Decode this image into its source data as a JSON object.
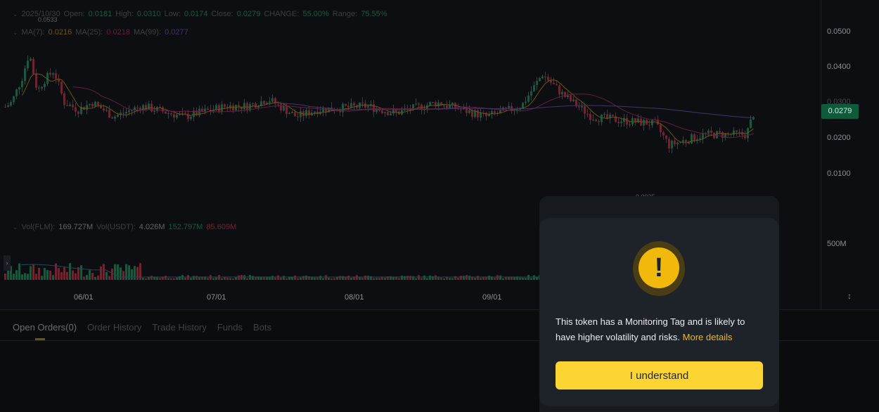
{
  "ohlc": {
    "date": "2025/10/30",
    "open_label": "Open:",
    "open": "0.0181",
    "high_label": "High:",
    "high": "0.0310",
    "low_label": "Low:",
    "low": "0.0174",
    "close_label": "Close:",
    "close": "0.0279",
    "change_label": "CHANGE:",
    "change": "55.00%",
    "range_label": "Range:",
    "range": "75.55%"
  },
  "ma": {
    "ma7_label": "MA(7):",
    "ma7": "0.0216",
    "ma25_label": "MA(25):",
    "ma25": "0.0218",
    "ma99_label": "MA(99):",
    "ma99": "0.0277"
  },
  "volume": {
    "flm_label": "Vol(FLM):",
    "flm": "169.727M",
    "usdt_label": "Vol(USDT):",
    "usdt": "4.026M",
    "v1": "152.797M",
    "v2": "85.609M"
  },
  "price_axis": {
    "ticks": [
      "0.0500",
      "0.0400",
      "0.0300",
      "0.0200",
      "0.0100"
    ],
    "volume_tick": "500M",
    "current_price": "0.0279"
  },
  "annotations": {
    "high_marker": "0.0533",
    "low_marker": "0.0025"
  },
  "dates": [
    "06/01",
    "07/01",
    "08/01",
    "09/01"
  ],
  "tabs": [
    {
      "label": "Open Orders(0)"
    },
    {
      "label": "Order History"
    },
    {
      "label": "Trade History"
    },
    {
      "label": "Funds"
    },
    {
      "label": "Bots"
    }
  ],
  "modal": {
    "message": "This token has a Monitoring Tag and is likely to have higher volatility and risks. ",
    "link": "More details",
    "button": "I understand",
    "icon": "warning-icon"
  },
  "colors": {
    "up": "#2ebd85",
    "down": "#f6465d",
    "accent": "#f0b90b",
    "button": "#fcd535"
  }
}
